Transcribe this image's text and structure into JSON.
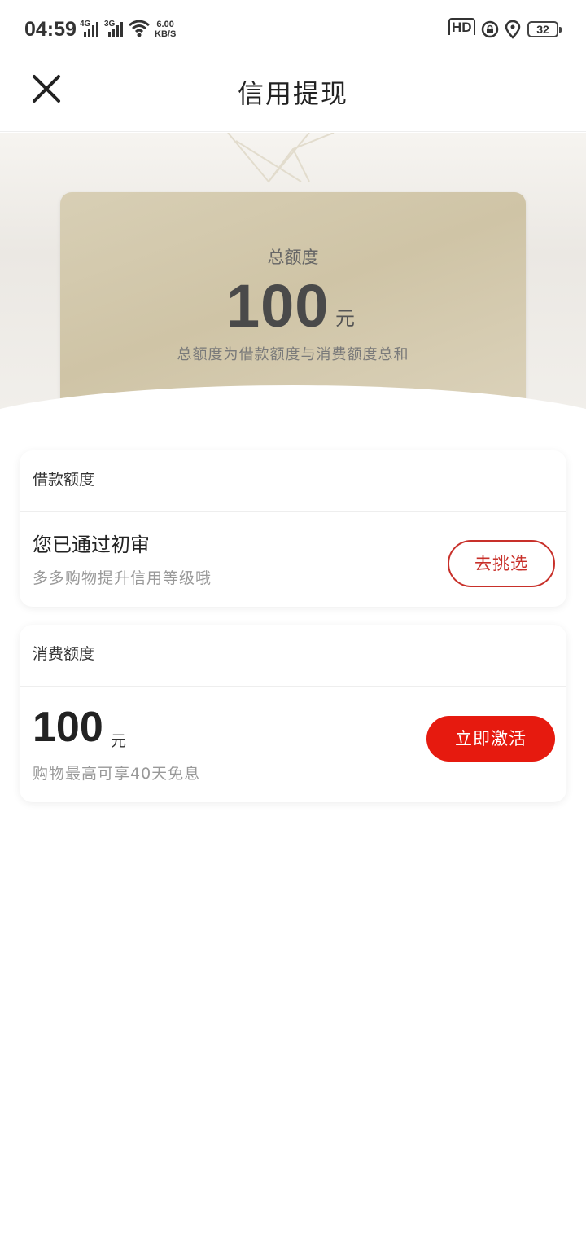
{
  "status_bar": {
    "time": "04:59",
    "net1": "4G",
    "net2": "3G",
    "speed_value": "6.00",
    "speed_unit": "KB/S",
    "hd_label": "HD",
    "battery": "32"
  },
  "header": {
    "title": "信用提现"
  },
  "hero": {
    "total_label": "总额度",
    "amount": "100",
    "unit": "元",
    "description": "总额度为借款额度与消费额度总和"
  },
  "loan_card": {
    "header": "借款额度",
    "title": "您已通过初审",
    "subtitle": "多多购物提升信用等级哦",
    "button_label": "去挑选"
  },
  "consume_card": {
    "header": "消费额度",
    "amount": "100",
    "unit": "元",
    "subtitle": "购物最高可享40天免息",
    "button_label": "立即激活"
  },
  "colors": {
    "accent_red": "#e61a0f",
    "outline_red": "#c8302a",
    "gold_card": "#d4caae"
  }
}
